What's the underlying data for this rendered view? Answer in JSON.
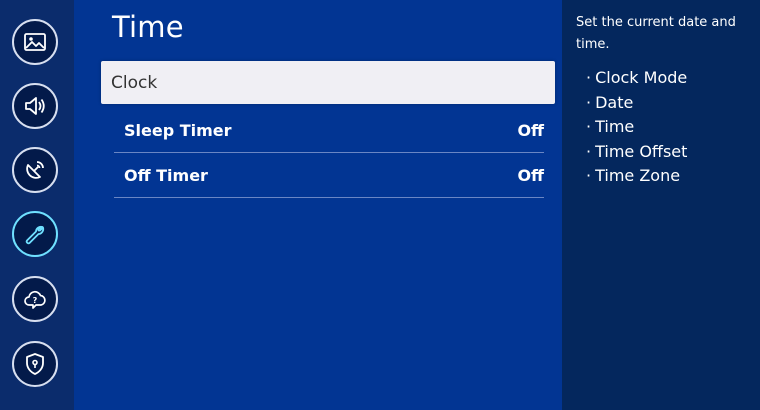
{
  "sidebar": {
    "items": [
      {
        "name": "picture",
        "icon": "picture-icon"
      },
      {
        "name": "sound",
        "icon": "speaker-icon"
      },
      {
        "name": "broadcasting",
        "icon": "satellite-dish-icon"
      },
      {
        "name": "general",
        "icon": "wrench-icon",
        "active": true
      },
      {
        "name": "support",
        "icon": "cloud-question-icon"
      },
      {
        "name": "privacy",
        "icon": "shield-lock-icon"
      }
    ]
  },
  "main": {
    "title": "Time",
    "items": [
      {
        "label": "Clock",
        "value": "",
        "focused": true
      },
      {
        "label": "Sleep Timer",
        "value": "Off"
      },
      {
        "label": "Off Timer",
        "value": "Off"
      }
    ]
  },
  "info": {
    "description": "Set the current date and time.",
    "bullet": "·",
    "list": [
      "Clock Mode",
      "Date",
      "Time",
      "Time Offset",
      "Time Zone"
    ]
  },
  "colors": {
    "background": "#023593",
    "sidebar": "#0b2c6c",
    "info_panel": "#04275d",
    "focus_row": "#f0eff4",
    "active_icon": "#6fe0ff"
  }
}
